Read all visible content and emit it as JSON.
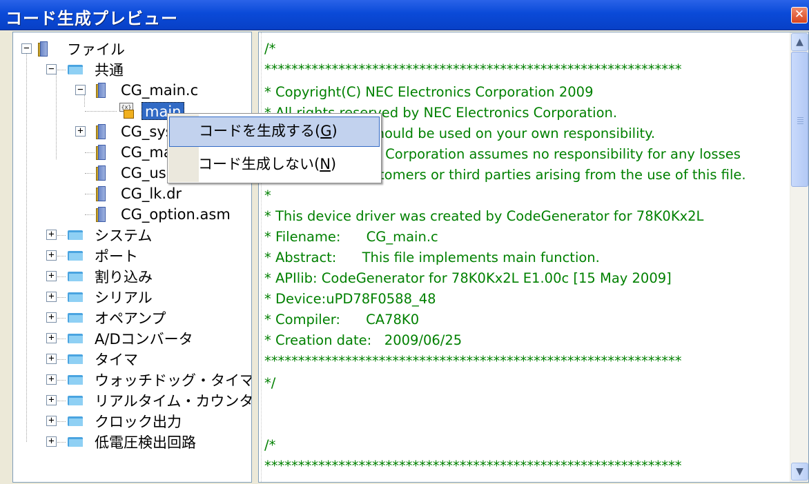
{
  "window": {
    "title": "コード生成プレビュー",
    "close_icon": "close-icon"
  },
  "tree": {
    "nodes": [
      {
        "label": "ファイル",
        "icon": "file-doc-icon",
        "expander": "−"
      },
      {
        "label": "共通",
        "icon": "folder-icon",
        "expander": "−"
      },
      {
        "label": "CG_main.c",
        "icon": "file-doc-icon",
        "expander": "−"
      },
      {
        "label": "main",
        "icon": "function-lock-icon",
        "selected": true
      },
      {
        "label": "CG_sys",
        "icon": "file-doc-icon",
        "expander": "+"
      },
      {
        "label": "CG_ma",
        "icon": "file-doc-icon"
      },
      {
        "label": "CG_us",
        "icon": "file-doc-icon"
      },
      {
        "label": "CG_lk.dr",
        "icon": "file-doc-icon"
      },
      {
        "label": "CG_option.asm",
        "icon": "file-doc-icon"
      },
      {
        "label": "システム",
        "icon": "folder-icon",
        "expander": "+"
      },
      {
        "label": "ポート",
        "icon": "folder-icon",
        "expander": "+"
      },
      {
        "label": "割り込み",
        "icon": "folder-icon",
        "expander": "+"
      },
      {
        "label": "シリアル",
        "icon": "folder-icon",
        "expander": "+"
      },
      {
        "label": "オペアンプ",
        "icon": "folder-icon",
        "expander": "+"
      },
      {
        "label": "A/Dコンバータ",
        "icon": "folder-icon",
        "expander": "+"
      },
      {
        "label": "タイマ",
        "icon": "folder-icon",
        "expander": "+"
      },
      {
        "label": "ウォッチドッグ・タイマ",
        "icon": "folder-icon",
        "expander": "+"
      },
      {
        "label": "リアルタイム・カウンタ",
        "icon": "folder-icon",
        "expander": "+"
      },
      {
        "label": "クロック出力",
        "icon": "folder-icon",
        "expander": "+"
      },
      {
        "label": "低電圧検出回路",
        "icon": "folder-icon",
        "expander": "+"
      }
    ]
  },
  "context_menu": {
    "items": [
      {
        "label_pre": "コードを生成する(",
        "mnemonic": "G",
        "label_post": ")"
      },
      {
        "label_pre": "コード生成しない(",
        "mnemonic": "N",
        "label_post": ")"
      }
    ]
  },
  "code": {
    "lines": [
      "/*",
      "**************************************************************",
      "* Copyright(C) NEC Electronics Corporation 2009",
      "* All rights reserved by NEC Electronics Corporation.",
      "* This program should be used on your own responsibility.",
      "* NEC Electronics Corporation assumes no responsibility for any losses",
      "* incurred by customers or third parties arising from the use of this file.",
      "*",
      "* This device driver was created by CodeGenerator for 78K0Kx2L",
      "* Filename:      CG_main.c",
      "* Abstract:      This file implements main function.",
      "* APIlib: CodeGenerator for 78K0Kx2L E1.00c [15 May 2009]",
      "* Device:uPD78F0588_48",
      "* Compiler:      CA78K0",
      "* Creation date:   2009/06/25",
      "**************************************************************",
      "*/",
      "",
      "",
      "/*",
      "**************************************************************"
    ]
  },
  "scrollbar": {
    "up_icon": "scroll-up-arrow-icon",
    "down_icon": "scroll-down-arrow-icon"
  }
}
